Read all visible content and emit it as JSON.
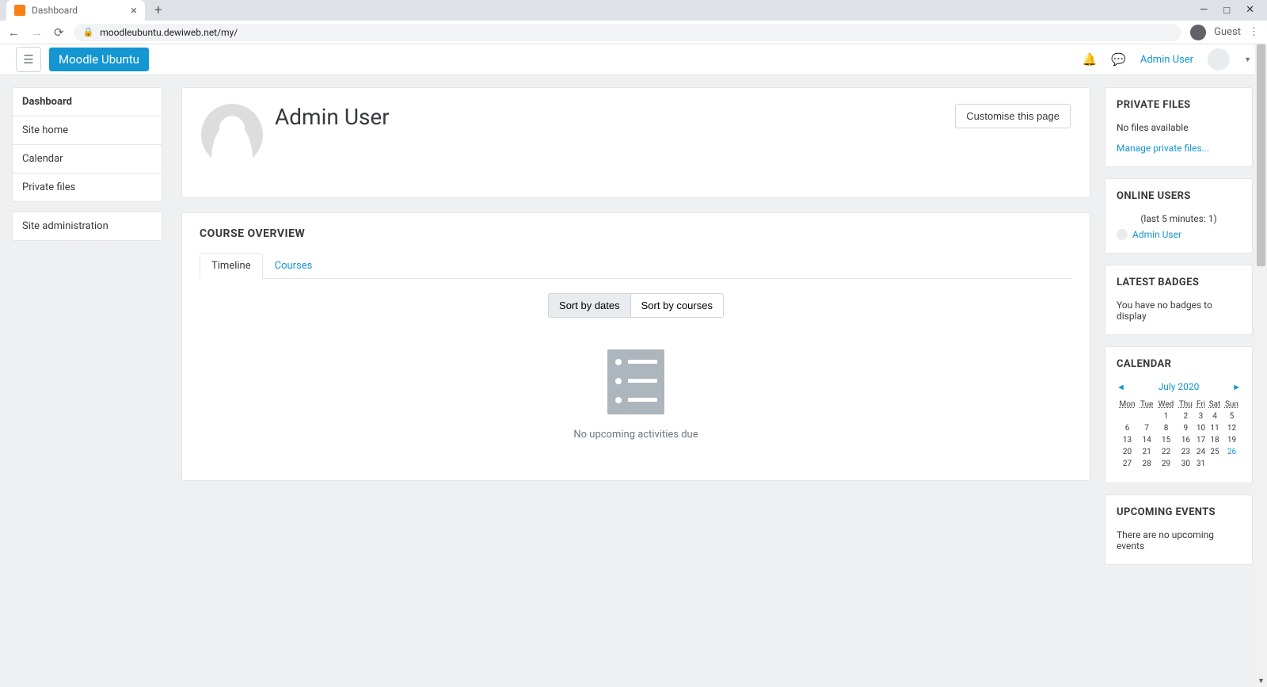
{
  "browser": {
    "tab_title": "Dashboard",
    "url": "moodleubuntu.dewiweb.net/my/",
    "guest_label": "Guest"
  },
  "nav": {
    "brand": "Moodle Ubuntu",
    "user_name": "Admin User"
  },
  "sidebar": {
    "items": [
      {
        "label": "Dashboard",
        "active": true
      },
      {
        "label": "Site home",
        "active": false
      },
      {
        "label": "Calendar",
        "active": false
      },
      {
        "label": "Private files",
        "active": false
      }
    ],
    "admin_item": {
      "label": "Site administration"
    }
  },
  "header": {
    "title": "Admin User",
    "customise_btn": "Customise this page"
  },
  "course_overview": {
    "title": "COURSE OVERVIEW",
    "tabs": [
      {
        "label": "Timeline",
        "active": true
      },
      {
        "label": "Courses",
        "active": false
      }
    ],
    "sort_buttons": [
      {
        "label": "Sort by dates",
        "active": true
      },
      {
        "label": "Sort by courses",
        "active": false
      }
    ],
    "empty_message": "No upcoming activities due"
  },
  "private_files": {
    "title": "PRIVATE FILES",
    "message": "No files available",
    "manage_link": "Manage private files..."
  },
  "online_users": {
    "title": "ONLINE USERS",
    "count_text": "(last 5 minutes: 1)",
    "users": [
      "Admin User"
    ]
  },
  "latest_badges": {
    "title": "LATEST BADGES",
    "message": "You have no badges to display"
  },
  "calendar": {
    "title": "CALENDAR",
    "month_label": "July 2020",
    "prev_arrow": "◄",
    "next_arrow": "►",
    "day_headers": [
      "Mon",
      "Tue",
      "Wed",
      "Thu",
      "Fri",
      "Sat",
      "Sun"
    ],
    "weeks": [
      [
        "",
        "",
        "1",
        "2",
        "3",
        "4",
        "5"
      ],
      [
        "6",
        "7",
        "8",
        "9",
        "10",
        "11",
        "12"
      ],
      [
        "13",
        "14",
        "15",
        "16",
        "17",
        "18",
        "19"
      ],
      [
        "20",
        "21",
        "22",
        "23",
        "24",
        "25",
        "26"
      ],
      [
        "27",
        "28",
        "29",
        "30",
        "31",
        "",
        ""
      ]
    ],
    "link_day": "26"
  },
  "upcoming_events": {
    "title": "UPCOMING EVENTS",
    "message": "There are no upcoming events"
  }
}
